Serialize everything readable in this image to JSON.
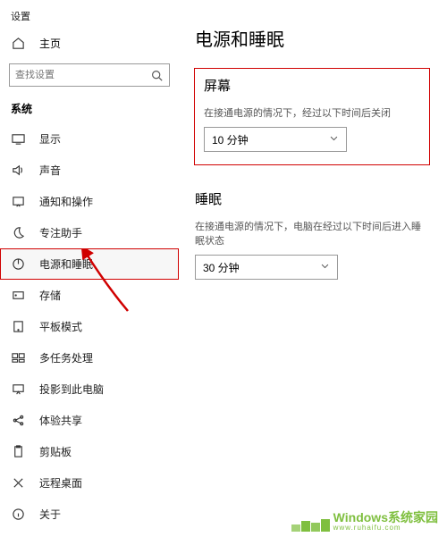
{
  "app_title": "设置",
  "home_label": "主页",
  "search": {
    "placeholder": "查找设置"
  },
  "section_label": "系统",
  "nav_items": [
    {
      "name": "display",
      "label": "显示"
    },
    {
      "name": "sound",
      "label": "声音"
    },
    {
      "name": "notifications",
      "label": "通知和操作"
    },
    {
      "name": "focus-assist",
      "label": "专注助手"
    },
    {
      "name": "power-sleep",
      "label": "电源和睡眠",
      "selected": true
    },
    {
      "name": "storage",
      "label": "存储"
    },
    {
      "name": "tablet-mode",
      "label": "平板模式"
    },
    {
      "name": "multitasking",
      "label": "多任务处理"
    },
    {
      "name": "projecting",
      "label": "投影到此电脑"
    },
    {
      "name": "shared-exp",
      "label": "体验共享"
    },
    {
      "name": "clipboard",
      "label": "剪贴板"
    },
    {
      "name": "remote-desktop",
      "label": "远程桌面"
    },
    {
      "name": "about",
      "label": "关于"
    }
  ],
  "page": {
    "title": "电源和睡眠",
    "screen": {
      "heading": "屏幕",
      "desc": "在接通电源的情况下，经过以下时间后关闭",
      "value": "10 分钟"
    },
    "sleep": {
      "heading": "睡眠",
      "desc": "在接通电源的情况下，电脑在经过以下时间后进入睡眠状态",
      "value": "30 分钟"
    }
  },
  "watermark": {
    "text": "indows系统家园",
    "sub": "www.ruhaifu.com"
  }
}
